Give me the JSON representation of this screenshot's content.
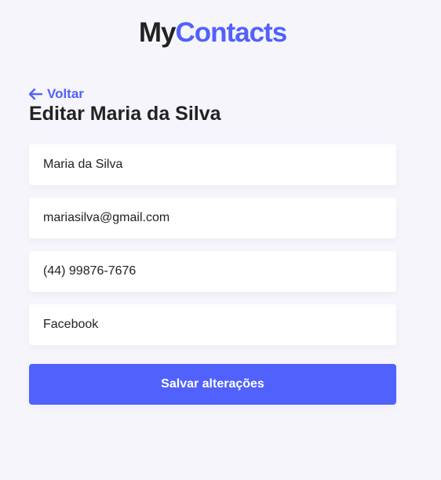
{
  "logo": {
    "part_1": "My",
    "part_2": "Contacts"
  },
  "header": {
    "back_label": "Voltar",
    "back_icon": "arrow-left-icon",
    "title": "Editar Maria da Silva"
  },
  "form": {
    "name_value": "Maria da Silva",
    "email_value": "mariasilva@gmail.com",
    "phone_value": "(44) 99876-7676",
    "category_value": "Facebook",
    "submit_label": "Salvar alterações"
  },
  "colors": {
    "background": "#f6f5fc",
    "primary": "#5061fc",
    "text": "#222222",
    "field_background": "#ffffff"
  }
}
